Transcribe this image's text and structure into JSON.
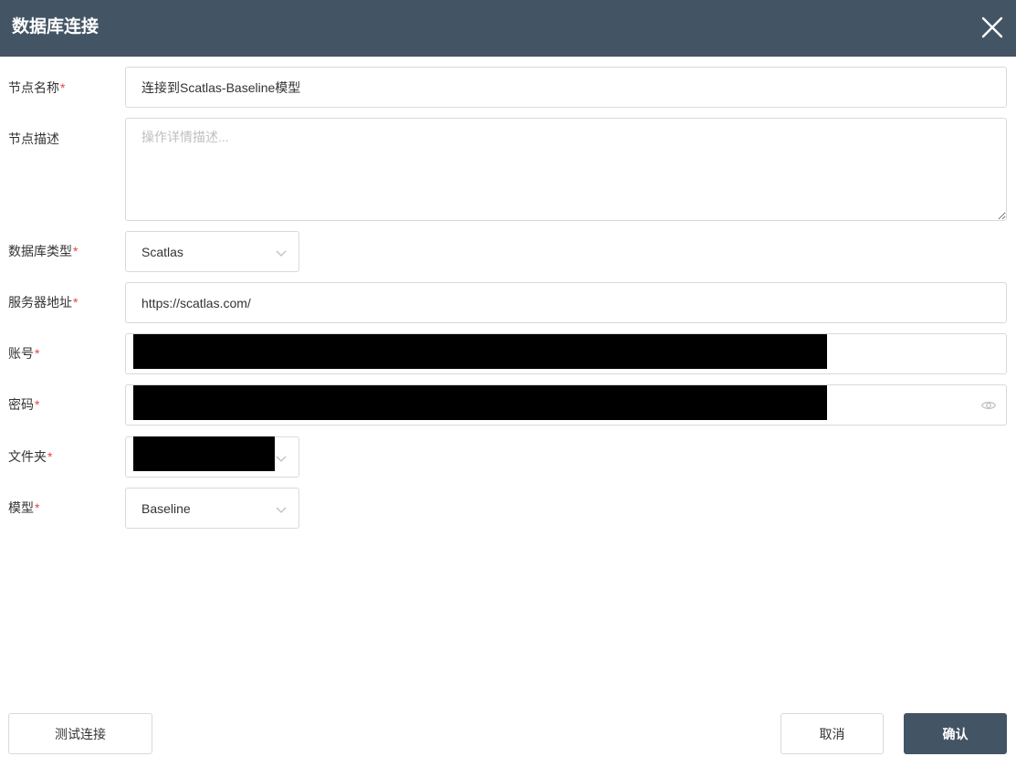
{
  "dialog": {
    "title": "数据库连接",
    "close_icon": "close-icon"
  },
  "form": {
    "node_name": {
      "label": "节点名称",
      "required": true,
      "value": "连接到Scatlas-Baseline模型"
    },
    "node_desc": {
      "label": "节点描述",
      "required": false,
      "value": "",
      "placeholder": "操作详情描述..."
    },
    "db_type": {
      "label": "数据库类型",
      "required": true,
      "value": "Scatlas"
    },
    "server": {
      "label": "服务器地址",
      "required": true,
      "value": "https://scatlas.com/"
    },
    "account": {
      "label": "账号",
      "required": true,
      "redacted": true
    },
    "password": {
      "label": "密码",
      "required": true,
      "redacted": true,
      "toggle_icon": "eye-icon"
    },
    "folder": {
      "label": "文件夹",
      "required": true,
      "redacted": true
    },
    "model": {
      "label": "模型",
      "required": true,
      "value": "Baseline"
    }
  },
  "footer": {
    "test_label": "测试连接",
    "cancel_label": "取消",
    "confirm_label": "确认"
  },
  "colors": {
    "header_bg": "#435464",
    "required": "#e64242",
    "border": "#d9d9d9",
    "primary": "#435464"
  },
  "required_mark": "*"
}
